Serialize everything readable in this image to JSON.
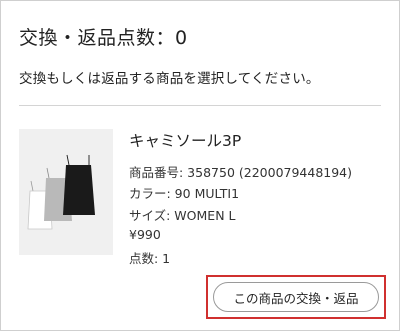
{
  "header": {
    "count_title": "交換・返品点数：0"
  },
  "instruction": "交換もしくは返品する商品を選択してください。",
  "product": {
    "image_icon": "camisole-3pack-photo",
    "image_colors": [
      "#1a1a1a",
      "#b9b9b9",
      "#ffffff"
    ],
    "name": "キャミソール3P",
    "item_number": "商品番号: 358750 (2200079448194)",
    "color": "カラー: 90 MULTI1",
    "size": "サイズ: WOMEN L",
    "price": "¥990",
    "quantity": "点数: 1"
  },
  "action": {
    "exchange_return_label": "この商品の交換・返品",
    "highlight_color": "#d0302f"
  }
}
